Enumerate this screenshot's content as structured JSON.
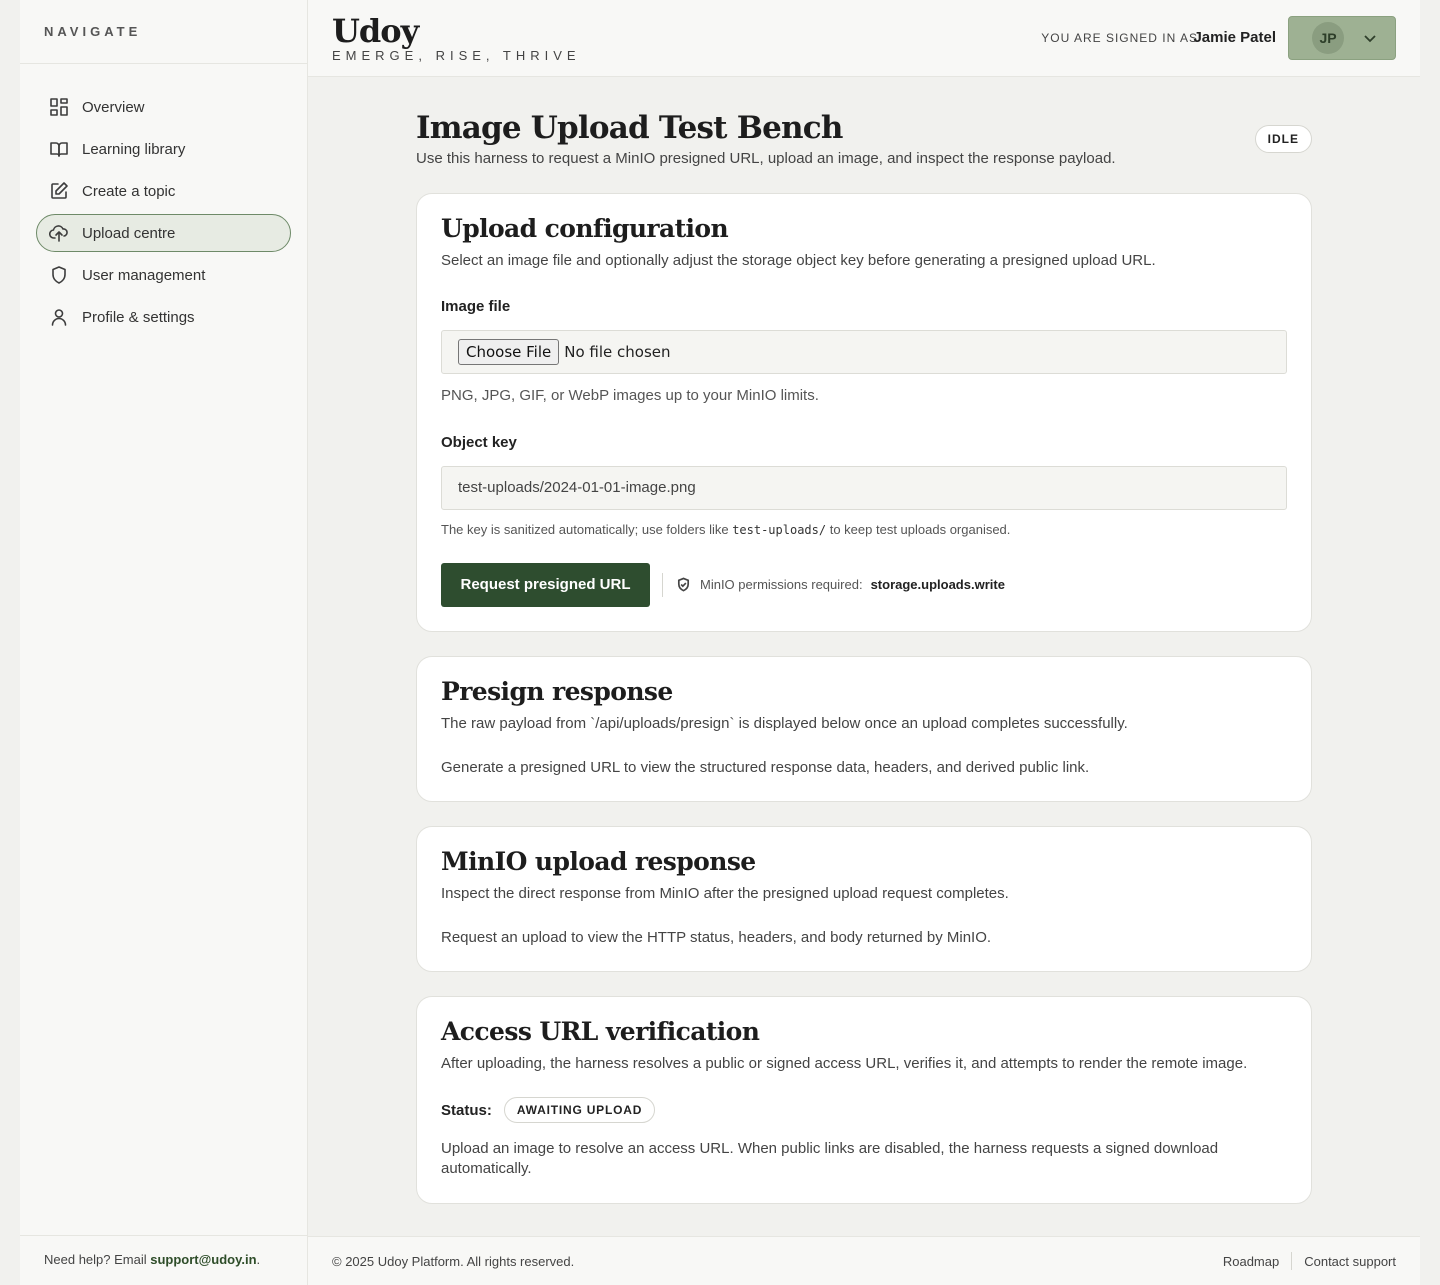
{
  "sidebar": {
    "heading": "NAVIGATE",
    "items": [
      {
        "label": "Overview",
        "icon": "grid-icon"
      },
      {
        "label": "Learning library",
        "icon": "book-icon"
      },
      {
        "label": "Create a topic",
        "icon": "edit-icon"
      },
      {
        "label": "Upload centre",
        "icon": "cloud-upload-icon",
        "active": true
      },
      {
        "label": "User management",
        "icon": "shield-icon"
      },
      {
        "label": "Profile & settings",
        "icon": "user-icon"
      }
    ],
    "help_prefix": "Need help? Email ",
    "help_email": "support@udoy.in",
    "help_suffix": "."
  },
  "header": {
    "brand": "Udoy",
    "tagline": "EMERGE, RISE, THRIVE",
    "signed_in_label": "YOU ARE SIGNED IN AS",
    "user_name": "Jamie Patel",
    "user_initials": "JP"
  },
  "page": {
    "title": "Image Upload Test Bench",
    "subtitle": "Use this harness to request a MinIO presigned URL, upload an image, and inspect the response payload.",
    "status_badge": "IDLE"
  },
  "upload_config": {
    "title": "Upload configuration",
    "description": "Select an image file and optionally adjust the storage object key before generating a presigned upload URL.",
    "file_label": "Image file",
    "choose_button": "Choose File",
    "no_file": "No file chosen",
    "file_hint": "PNG, JPG, GIF, or WebP images up to your MinIO limits.",
    "key_label": "Object key",
    "key_placeholder": "test-uploads/2024-01-01-image.png",
    "key_hint_before": "The key is sanitized automatically; use folders like ",
    "key_hint_code": "test-uploads/",
    "key_hint_after": " to keep test uploads organised.",
    "request_button": "Request presigned URL",
    "permission_label": "MinIO permissions required:",
    "permission_value": "storage.uploads.write"
  },
  "presign_response": {
    "title": "Presign response",
    "description": "The raw payload from `/api/uploads/presign` is displayed below once an upload completes successfully.",
    "empty": "Generate a presigned URL to view the structured response data, headers, and derived public link."
  },
  "minio_response": {
    "title": "MinIO upload response",
    "description": "Inspect the direct response from MinIO after the presigned upload request completes.",
    "empty": "Request an upload to view the HTTP status, headers, and body returned by MinIO."
  },
  "access_verification": {
    "title": "Access URL verification",
    "description": "After uploading, the harness resolves a public or signed access URL, verifies it, and attempts to render the remote image.",
    "status_label": "Status:",
    "status_value": "AWAITING UPLOAD",
    "body": "Upload an image to resolve an access URL. When public links are disabled, the harness requests a signed download automatically."
  },
  "footer": {
    "copyright": "© 2025 Udoy Platform. All rights reserved.",
    "links": [
      "Roadmap",
      "Contact support"
    ]
  },
  "colors": {
    "accent": "#2e4d2f",
    "sage": "#9eb193",
    "background": "#f1f1ee"
  }
}
